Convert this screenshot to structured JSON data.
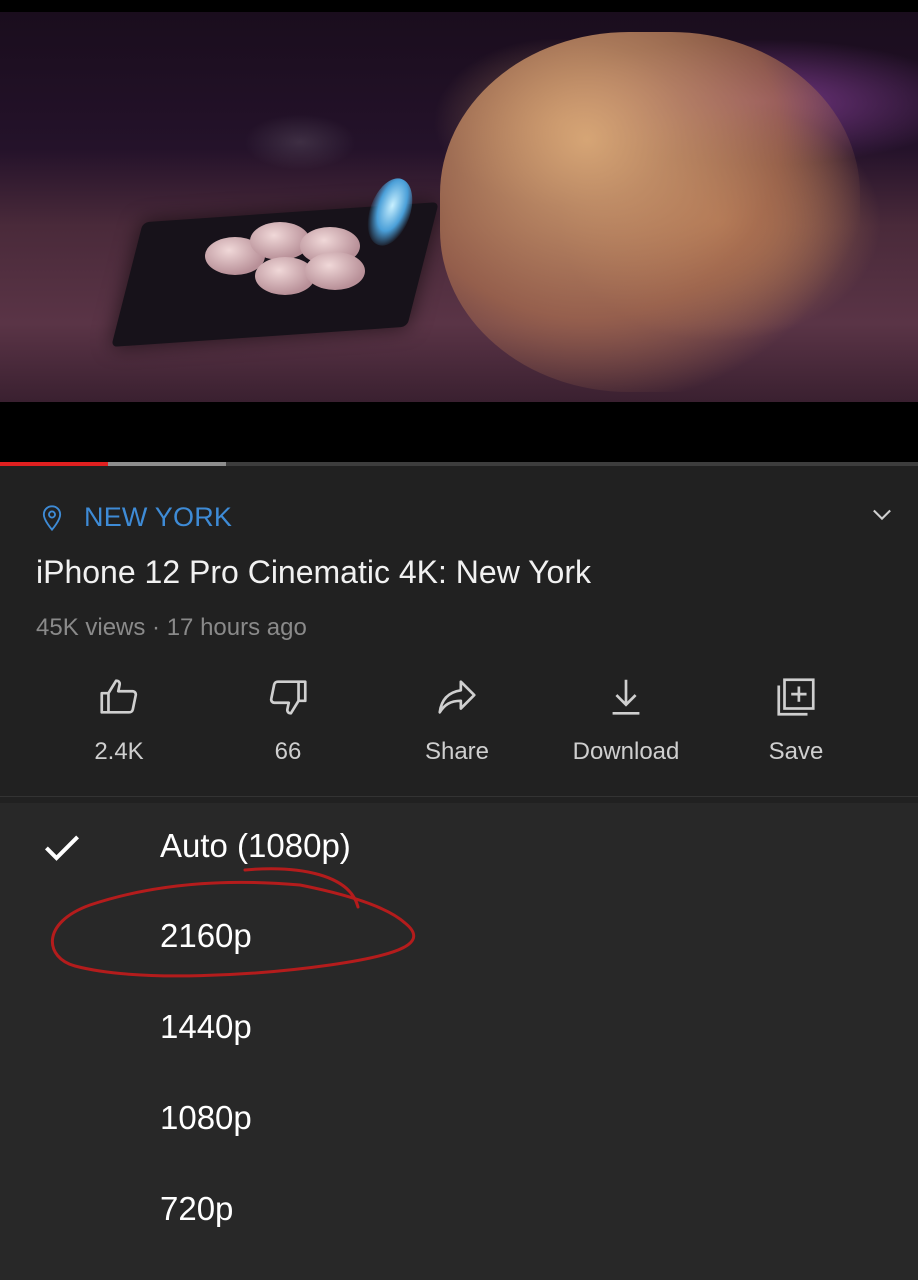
{
  "video": {
    "progress_played": 0.118,
    "progress_buffered": 0.246,
    "accent_color": "#e02020"
  },
  "info": {
    "location": "NEW YORK",
    "location_icon": "location-pin-icon",
    "title": "iPhone 12 Pro Cinematic 4K: New York",
    "meta": "45K views · 17 hours ago",
    "actions": [
      {
        "icon": "thumbs-up-icon",
        "label": "2.4K"
      },
      {
        "icon": "thumbs-down-icon",
        "label": "66"
      },
      {
        "icon": "share-icon",
        "label": "Share"
      },
      {
        "icon": "download-icon",
        "label": "Download"
      },
      {
        "icon": "save-playlist-icon",
        "label": "Save"
      }
    ]
  },
  "quality_menu": {
    "selected": "Auto (1080p)",
    "options": [
      "Auto (1080p)",
      "2160p",
      "1440p",
      "1080p",
      "720p"
    ],
    "annotation_color": "#b41c1c"
  }
}
